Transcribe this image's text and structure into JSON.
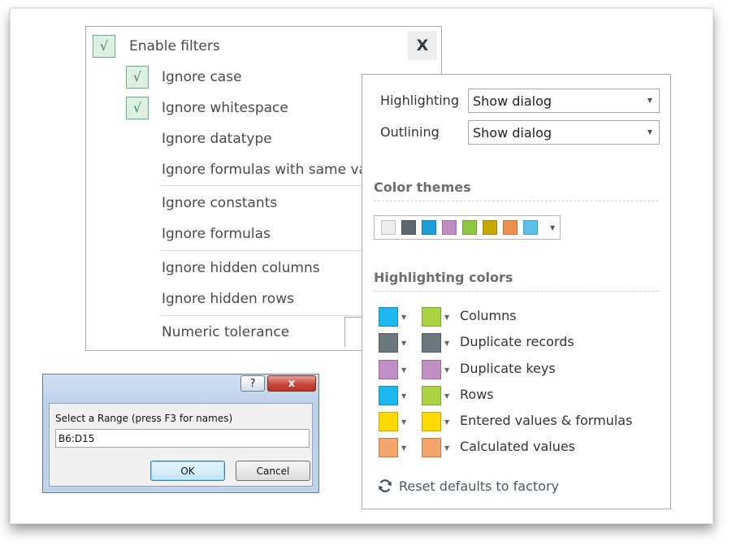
{
  "filters": {
    "close_label": "X",
    "check_mark": "√",
    "items": [
      {
        "label": "Enable filters",
        "checked": true
      },
      {
        "label": "Ignore case",
        "checked": true
      },
      {
        "label": "Ignore whitespace",
        "checked": true
      },
      {
        "label": "Ignore datatype",
        "checked": false
      },
      {
        "label": "Ignore formulas with same va",
        "checked": false
      },
      {
        "label": "Ignore constants",
        "checked": false
      },
      {
        "label": "Ignore formulas",
        "checked": false
      },
      {
        "label": "Ignore hidden columns",
        "checked": false
      },
      {
        "label": "Ignore hidden rows",
        "checked": false
      }
    ],
    "tolerance_label": "Numeric tolerance"
  },
  "settings": {
    "highlighting_label": "Highlighting",
    "highlighting_value": "Show dialog",
    "outlining_label": "Outlining",
    "outlining_value": "Show dialog",
    "color_themes_title": "Color themes",
    "theme_swatches": [
      "#eeeeee",
      "#5b6670",
      "#1a9fd9",
      "#c08bc0",
      "#8dc63f",
      "#c6a800",
      "#f28c4a",
      "#5bc0ee"
    ],
    "highlighting_colors_title": "Highlighting colors",
    "highlighting_colors": [
      {
        "label": "Columns",
        "primary": "#1fb7ef",
        "secondary": "#a8d444"
      },
      {
        "label": "Duplicate records",
        "primary": "#6c7880",
        "secondary": "#6c7880"
      },
      {
        "label": "Duplicate keys",
        "primary": "#c28ec6",
        "secondary": "#c28ec6"
      },
      {
        "label": "Rows",
        "primary": "#1fb7ef",
        "secondary": "#a8d444"
      },
      {
        "label": "Entered values & formulas",
        "primary": "#ffd900",
        "secondary": "#ffd900"
      },
      {
        "label": "Calculated values",
        "primary": "#f4a56b",
        "secondary": "#f4a56b"
      }
    ],
    "reset_label": "Reset defaults to factory"
  },
  "dialog": {
    "help_label": "?",
    "close_label": "x",
    "prompt": "Select a Range (press F3 for names)",
    "range_value": "B6:D15",
    "ok_label": "OK",
    "cancel_label": "Cancel"
  }
}
